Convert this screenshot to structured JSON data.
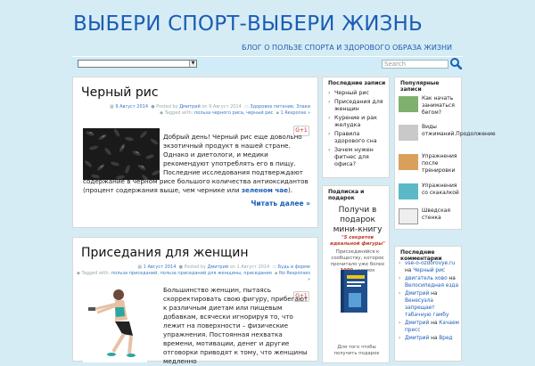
{
  "site": {
    "title": "ВЫБЕРИ СПОРТ-ВЫБЕРИ ЖИЗНЬ",
    "tagline": "БЛОГ О ПОЛЬЗЕ СПОРТА И ЗДОРОВОГО ОБРАЗА ЖИЗНИ"
  },
  "nav": {
    "search_placeholder": "Search"
  },
  "posts": [
    {
      "title": "Черный рис",
      "date": "9 Август 2014",
      "author_prefix": "Posted by",
      "author": "Дмитрий",
      "on": "on 9 Август 2014",
      "categories": "Здоровое питание, Злаки",
      "tags_prefix": "Tagged with:",
      "tags": "польза черного риса, черный рис",
      "responses": "1 Response »",
      "gplus": "G+1",
      "excerpt_pre": "Добрый день! Черный рис еще довольно экзотичный продукт в нашей стране. Однако и диетологи, и медики рекомендуют употреблять его в пищу. Последние исследования подтверждают  содержание в черном рисе большого количества антиоксидантов (процент содержания выше, чем чернике или",
      "excerpt_link": "зеленом чае",
      "excerpt_post": ").",
      "read_more": "Читать далее »"
    },
    {
      "title": "Приседания для женщин",
      "date": "1 Август 2014",
      "author_prefix": "Posted by",
      "author": "Дмитрий",
      "on": "on 1 Август 2014",
      "categories": "Будь в форме",
      "tags_prefix": "Tagged with:",
      "tags": "польза приседаний, польза приседаний для женщины, приседания",
      "responses": "No Responses »",
      "gplus": "G+1",
      "excerpt": "Большинство женщин, пытаясь скорректировать свою фигуру, прибегают к различным диетам или пищевым добавкам, всячески игнорируя то, что лежит на поверхности – физические упражнения. Постоянная нехватка времени, мотивации, денег и другие отговорки приводят к тому, что женщины медленно"
    }
  ],
  "recent": {
    "title": "Последние записи",
    "items": [
      "Черный рис",
      "Приседания для женщин",
      "Курение и рак желудка",
      "Правила здорового сна",
      "Зачем нужен фитнес для офиса?"
    ]
  },
  "subscribe": {
    "title": "Подписка и подарок",
    "headline": "Получи в подарок мини-книгу",
    "red": "\"5 секретов идеальной фигуры\"",
    "text_pre": "Присоединяйся к сообществу, которое прочитало уже более",
    "count": "1000",
    "text_post": "человек",
    "bottom": "Для того чтобы получить подарок"
  },
  "popular": {
    "title": "Популярные записи",
    "items": [
      "Как начать заниматься бегом?",
      "Виды отжиманий.Продолжение",
      "Упражнения после тренировки",
      "Упражнения со скакалкой",
      "Шведская стенка"
    ]
  },
  "comments": {
    "title": "Последние комментарии",
    "items": [
      {
        "author": "vse-o-ozdorovye.ru",
        "post": "Черный рис"
      },
      {
        "author": "двигатель хово",
        "post": "Велосипедная езда"
      },
      {
        "author": "Дмитрий",
        "post": "Венесуэла запрещает табачную гамбу"
      },
      {
        "author": "Дмитрий",
        "post": "Качаем пресс"
      },
      {
        "author": "Дмитрий",
        "post": "Вред"
      }
    ]
  },
  "colors": {
    "background": "#d6ecf4",
    "accent": "#1a5db5",
    "red": "#c0392b"
  }
}
